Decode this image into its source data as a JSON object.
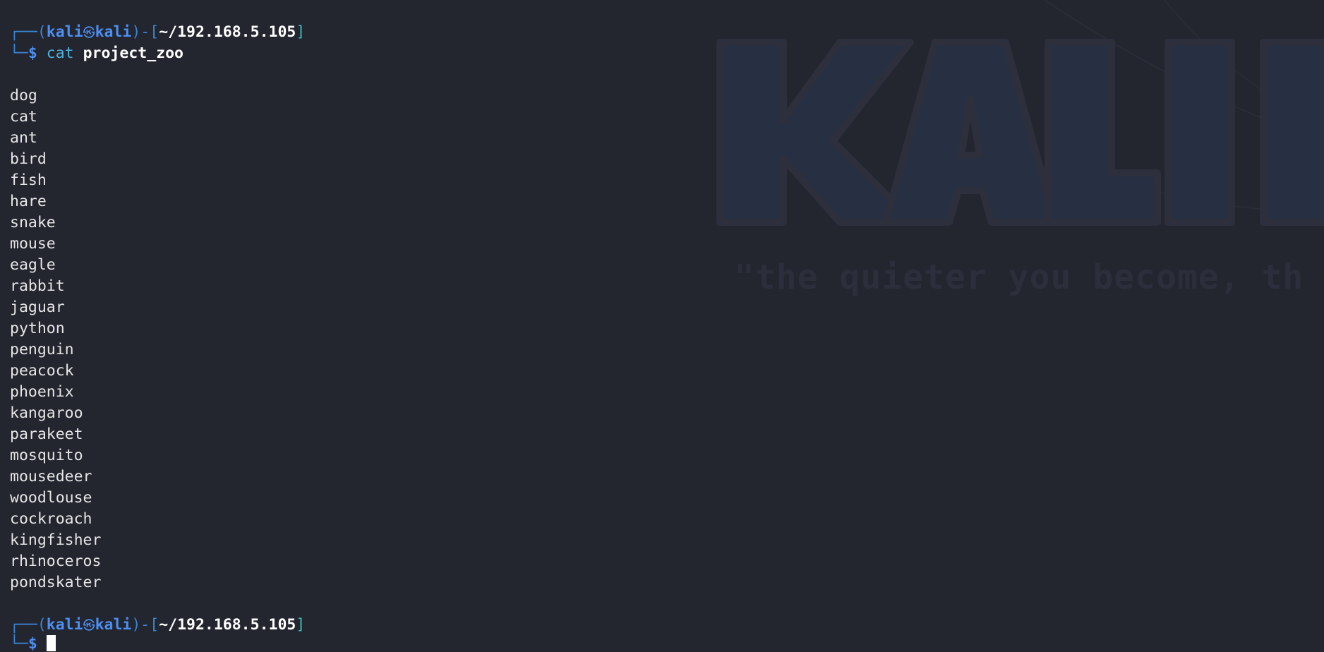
{
  "prompt": {
    "corner_top": "┌──(",
    "user": "kali",
    "skull_icon": "㉿",
    "host": "kali",
    "mid": ")-[",
    "cwd": "~/192.168.5.105",
    "close": "]",
    "corner_bottom": "└─",
    "dollar": "$"
  },
  "command": {
    "name": "cat",
    "argument": "project_zoo"
  },
  "output": [
    "dog",
    "cat",
    "ant",
    "bird",
    "fish",
    "hare",
    "snake",
    "mouse",
    "eagle",
    "rabbit",
    "jaguar",
    "python",
    "penguin",
    "peacock",
    "phoenix",
    "kangaroo",
    "parakeet",
    "mosquito",
    "mousedeer",
    "woodlouse",
    "cockroach",
    "kingfisher",
    "rhinoceros",
    "pondskater"
  ],
  "wallpaper": {
    "logo_text": "KALI L",
    "motto": "\"the quieter you become, th"
  },
  "colors": {
    "background": "#23252f",
    "prompt_blue": "#4d8ff0",
    "bracket_teal": "#3fbcbc",
    "command_cyan": "#4db0d8",
    "text": "#e6e6e6"
  }
}
